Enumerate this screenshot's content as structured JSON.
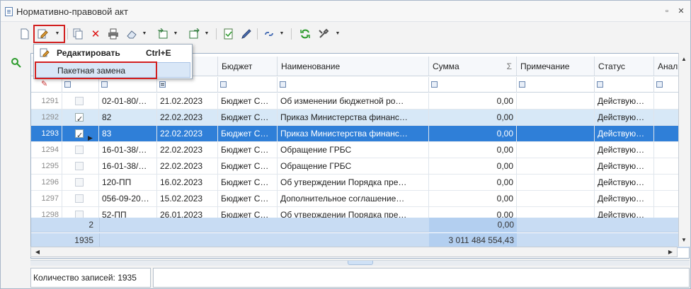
{
  "window": {
    "title": "Нормативно-правовой акт"
  },
  "menu": {
    "items": [
      {
        "label": "Редактировать",
        "shortcut": "Ctrl+E"
      },
      {
        "label": "Пакетная замена",
        "shortcut": ""
      }
    ]
  },
  "grid": {
    "columns": [
      "Бюджет",
      "Наименование",
      "Сумма",
      "Примечание",
      "Статус",
      "Анал"
    ],
    "sum_symbol": "Σ",
    "rows": [
      {
        "num": "1291",
        "checked": false,
        "code": "02-01-80/…",
        "date": "21.02.2023",
        "budget": "Бюджет С…",
        "name": "Об изменении бюджетной ро…",
        "sum": "0,00",
        "note": "",
        "status": "Действую…"
      },
      {
        "num": "1292",
        "checked": true,
        "code": "82",
        "date": "22.02.2023",
        "budget": "Бюджет С…",
        "name": "Приказ Министерства финанс…",
        "sum": "0,00",
        "note": "",
        "status": "Действую…"
      },
      {
        "num": "1293",
        "checked": true,
        "code": "83",
        "date": "22.02.2023",
        "budget": "Бюджет С…",
        "name": "Приказ Министерства финанс…",
        "sum": "0,00",
        "note": "",
        "status": "Действую…"
      },
      {
        "num": "1294",
        "checked": false,
        "code": "16-01-38/…",
        "date": "22.02.2023",
        "budget": "Бюджет С…",
        "name": "Обращение ГРБС",
        "sum": "0,00",
        "note": "",
        "status": "Действую…"
      },
      {
        "num": "1295",
        "checked": false,
        "code": "16-01-38/…",
        "date": "22.02.2023",
        "budget": "Бюджет С…",
        "name": "Обращение ГРБС",
        "sum": "0,00",
        "note": "",
        "status": "Действую…"
      },
      {
        "num": "1296",
        "checked": false,
        "code": "120-ПП",
        "date": "16.02.2023",
        "budget": "Бюджет С…",
        "name": "Об утверждении Порядка пре…",
        "sum": "0,00",
        "note": "",
        "status": "Действую…"
      },
      {
        "num": "1297",
        "checked": false,
        "code": "056-09-20…",
        "date": "15.02.2023",
        "budget": "Бюджет С…",
        "name": "Дополнительное  соглашение…",
        "sum": "0,00",
        "note": "",
        "status": "Действую…"
      },
      {
        "num": "1298",
        "checked": false,
        "code": "52-ПП",
        "date": "26.01.2023",
        "budget": "Бюджет С…",
        "name": "Об утверждении Порядка пре…",
        "sum": "0,00",
        "note": "",
        "status": "Действую…"
      }
    ],
    "summary": [
      {
        "left": "2",
        "sum": "0,00"
      },
      {
        "left": "1935",
        "sum": "3 011 484 554,43"
      }
    ]
  },
  "status": {
    "records": "Количество записей: 1935"
  }
}
